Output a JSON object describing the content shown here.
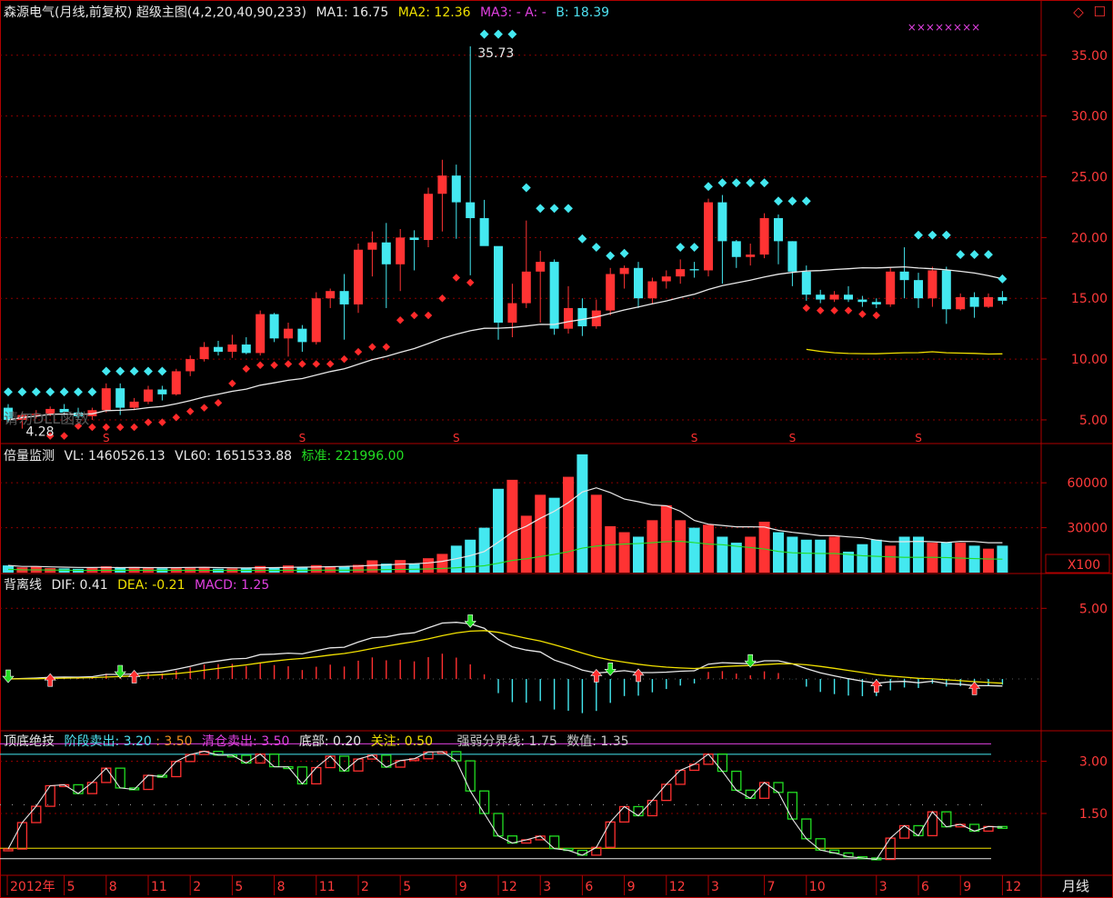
{
  "window_buttons": {
    "diamond": "◇",
    "box": "☐"
  },
  "panels": {
    "main": {
      "title": "森源电气(月线,前复权) 超级主图(4,2,20,40,90,233)",
      "ma1": "MA1: 16.75",
      "ma2": "MA2: 12.36",
      "ma3": "MA3: - A: -",
      "b": "B: 18.39",
      "markers": "××××××××",
      "peak_label": "35.73",
      "low_label": "4.28",
      "watermark": "请勿DLL函数",
      "s_marker": "S",
      "ticks": [
        "35.00",
        "30.00",
        "25.00",
        "20.00",
        "15.00",
        "10.00",
        "5.00"
      ]
    },
    "volume": {
      "name": "倍量监测",
      "vl": "VL: 1460526.13",
      "vl60": "VL60: 1651533.88",
      "std": "标准: 221996.00",
      "ticks": [
        "60000",
        "30000"
      ],
      "unit": "X100"
    },
    "macd": {
      "name": "背离线",
      "dif": "DIF: 0.41",
      "dea": "DEA: -0.21",
      "macd": "MACD: 1.25",
      "ticks": [
        "5.00"
      ]
    },
    "topbottom": {
      "name": "顶底绝技",
      "stage": "阶段卖出: 3.20",
      "stage2": ": 3.50",
      "clear": "清仓卖出: 3.50",
      "bottom": "底部: 0.20",
      "watch": "关注: 0.50",
      "divider": "强弱分界线: 1.75",
      "value": "数值: 1.35",
      "ticks": [
        "3.00",
        "1.50"
      ]
    }
  },
  "x_axis": {
    "labels": [
      "2012年",
      "5",
      "8",
      "11",
      "2",
      "5",
      "8",
      "11",
      "2",
      "5",
      "9",
      "12",
      "3",
      "6",
      "9",
      "12",
      "3",
      "7",
      "10",
      "3",
      "6",
      "9",
      "12"
    ]
  },
  "period_label": "月线",
  "colors": {
    "up": "#ff3333",
    "down": "#44e8f0",
    "grid": "#8a0000",
    "axis": "#b00000"
  },
  "chart_data": {
    "type": "candlestick",
    "months": [
      "2012-01",
      "2012-02",
      "2012-03",
      "2012-04",
      "2012-05",
      "2012-06",
      "2012-07",
      "2012-08",
      "2012-09",
      "2012-10",
      "2012-11",
      "2012-12",
      "2013-01",
      "2013-02",
      "2013-03",
      "2013-04",
      "2013-05",
      "2013-06",
      "2013-07",
      "2013-08",
      "2013-09",
      "2013-10",
      "2013-11",
      "2013-12",
      "2014-01",
      "2014-02",
      "2014-03",
      "2014-04",
      "2014-05",
      "2014-06",
      "2014-07",
      "2014-08",
      "2014-09",
      "2014-10",
      "2014-11",
      "2014-12",
      "2015-01",
      "2015-02",
      "2015-03",
      "2015-04",
      "2015-05",
      "2015-06",
      "2015-07",
      "2015-08",
      "2015-09",
      "2015-10",
      "2015-11",
      "2015-12",
      "2016-01",
      "2016-02",
      "2016-03",
      "2016-04",
      "2016-05",
      "2016-06",
      "2016-07",
      "2016-08",
      "2016-09",
      "2016-10",
      "2016-11",
      "2016-12",
      "2017-01",
      "2017-02",
      "2017-03",
      "2017-04",
      "2017-05",
      "2017-06",
      "2017-07",
      "2017-08",
      "2017-09",
      "2017-10",
      "2017-11",
      "2017-12"
    ],
    "ohlc": [
      [
        6.0,
        6.3,
        4.8,
        5.0
      ],
      [
        5.0,
        5.6,
        4.28,
        5.4
      ],
      [
        5.4,
        5.8,
        5.1,
        5.5
      ],
      [
        5.5,
        6.1,
        5.3,
        5.9
      ],
      [
        5.9,
        6.3,
        5.4,
        5.6
      ],
      [
        5.6,
        6.0,
        5.1,
        5.3
      ],
      [
        5.3,
        6.0,
        5.0,
        5.8
      ],
      [
        5.8,
        8.0,
        5.6,
        7.6
      ],
      [
        7.6,
        8.0,
        5.4,
        6.0
      ],
      [
        6.0,
        6.8,
        5.8,
        6.5
      ],
      [
        6.5,
        7.8,
        6.3,
        7.5
      ],
      [
        7.5,
        7.8,
        6.6,
        7.1
      ],
      [
        7.1,
        9.2,
        7.0,
        9.0
      ],
      [
        9.0,
        10.3,
        8.6,
        10.0
      ],
      [
        10.0,
        11.4,
        9.8,
        11.0
      ],
      [
        11.0,
        11.5,
        10.3,
        10.6
      ],
      [
        10.6,
        12.0,
        10.1,
        11.2
      ],
      [
        11.2,
        11.8,
        10.4,
        10.5
      ],
      [
        10.5,
        14.0,
        10.3,
        13.7
      ],
      [
        13.7,
        13.8,
        11.4,
        11.7
      ],
      [
        11.7,
        13.0,
        10.2,
        12.5
      ],
      [
        12.5,
        12.8,
        10.6,
        11.4
      ],
      [
        11.4,
        15.5,
        11.2,
        15.0
      ],
      [
        15.0,
        15.8,
        14.2,
        15.6
      ],
      [
        15.6,
        17.0,
        11.6,
        14.5
      ],
      [
        14.5,
        19.5,
        13.8,
        19.0
      ],
      [
        19.0,
        20.5,
        16.8,
        19.6
      ],
      [
        19.6,
        21.2,
        14.2,
        17.8
      ],
      [
        17.8,
        20.7,
        15.6,
        20.0
      ],
      [
        20.0,
        20.6,
        17.3,
        19.8
      ],
      [
        19.8,
        24.1,
        19.2,
        23.6
      ],
      [
        23.6,
        26.4,
        20.5,
        25.1
      ],
      [
        25.1,
        26.0,
        19.9,
        22.9
      ],
      [
        22.9,
        35.73,
        16.9,
        21.6
      ],
      [
        21.6,
        23.1,
        19.6,
        19.3
      ],
      [
        19.3,
        18.7,
        11.6,
        13.0
      ],
      [
        13.0,
        16.2,
        11.8,
        14.6
      ],
      [
        14.6,
        21.4,
        14.2,
        17.2
      ],
      [
        17.2,
        18.9,
        13.0,
        18.0
      ],
      [
        18.0,
        18.2,
        12.0,
        12.5
      ],
      [
        12.5,
        16.0,
        12.1,
        14.2
      ],
      [
        14.2,
        15.0,
        11.9,
        12.7
      ],
      [
        12.7,
        14.9,
        12.5,
        14.0
      ],
      [
        14.0,
        17.5,
        13.6,
        17.0
      ],
      [
        17.0,
        17.7,
        15.8,
        17.5
      ],
      [
        17.5,
        18.0,
        14.2,
        15.0
      ],
      [
        15.0,
        16.7,
        14.5,
        16.4
      ],
      [
        16.4,
        17.3,
        15.8,
        16.8
      ],
      [
        16.8,
        18.2,
        16.2,
        17.4
      ],
      [
        17.4,
        18.0,
        16.7,
        17.3
      ],
      [
        17.3,
        23.2,
        16.8,
        22.9
      ],
      [
        22.9,
        23.5,
        16.2,
        19.7
      ],
      [
        19.7,
        19.8,
        17.5,
        18.4
      ],
      [
        18.4,
        19.5,
        17.7,
        18.6
      ],
      [
        18.6,
        22.0,
        18.3,
        21.6
      ],
      [
        21.6,
        21.9,
        17.8,
        19.7
      ],
      [
        19.7,
        19.7,
        16.0,
        17.2
      ],
      [
        17.2,
        17.7,
        14.8,
        15.3
      ],
      [
        15.3,
        15.7,
        14.6,
        14.9
      ],
      [
        14.9,
        15.6,
        14.7,
        15.3
      ],
      [
        15.3,
        16.0,
        14.7,
        14.9
      ],
      [
        14.9,
        15.2,
        14.3,
        14.7
      ],
      [
        14.7,
        15.0,
        14.2,
        14.5
      ],
      [
        14.5,
        17.5,
        14.3,
        17.2
      ],
      [
        17.2,
        19.2,
        15.0,
        16.5
      ],
      [
        16.5,
        17.1,
        14.2,
        15.0
      ],
      [
        15.0,
        17.6,
        14.3,
        17.3
      ],
      [
        17.3,
        17.6,
        12.9,
        14.1
      ],
      [
        14.1,
        15.4,
        14.0,
        15.1
      ],
      [
        15.1,
        15.5,
        13.4,
        14.3
      ],
      [
        14.3,
        15.4,
        14.2,
        15.1
      ],
      [
        15.1,
        15.6,
        14.5,
        14.8
      ]
    ],
    "volume_x100": [
      4800,
      3500,
      4000,
      3000,
      2800,
      2500,
      3200,
      4200,
      3600,
      3800,
      3500,
      2900,
      3000,
      3400,
      3800,
      2600,
      2800,
      3100,
      4400,
      3500,
      4800,
      3900,
      5000,
      4200,
      4100,
      5200,
      8200,
      6000,
      8400,
      6200,
      9600,
      12500,
      18000,
      22000,
      30000,
      56000,
      62000,
      38000,
      52000,
      50000,
      64000,
      79000,
      52000,
      31000,
      27000,
      24000,
      35000,
      45000,
      35000,
      30000,
      32000,
      24000,
      20000,
      24000,
      34000,
      27000,
      24000,
      22000,
      22000,
      24000,
      14000,
      19000,
      22000,
      18000,
      24000,
      24000,
      20000,
      20000,
      20000,
      18000,
      16000,
      18000
    ],
    "series": [
      {
        "name": "MA1",
        "last": 16.75
      },
      {
        "name": "MA2",
        "last": 12.36
      },
      {
        "name": "B",
        "last": 18.39
      },
      {
        "name": "VL",
        "last": 1460526.13
      },
      {
        "name": "VL60",
        "last": 1651533.88
      },
      {
        "name": "标准",
        "last": 221996.0
      },
      {
        "name": "DIF",
        "last": 0.41
      },
      {
        "name": "DEA",
        "last": -0.21
      },
      {
        "name": "MACD",
        "last": 1.25
      },
      {
        "name": "阶段卖出",
        "last": 3.2
      },
      {
        "name": "清仓卖出",
        "last": 3.5
      },
      {
        "name": "底部",
        "last": 0.2
      },
      {
        "name": "关注",
        "last": 0.5
      },
      {
        "name": "强弱分界线",
        "last": 1.75
      },
      {
        "name": "数值",
        "last": 1.35
      }
    ],
    "price_range": [
      3.8,
      37.6
    ],
    "volume_range": [
      0,
      85000
    ],
    "macd_range": [
      -3.6,
      7.4
    ],
    "topbottom_range": [
      -0.25,
      3.85
    ]
  }
}
